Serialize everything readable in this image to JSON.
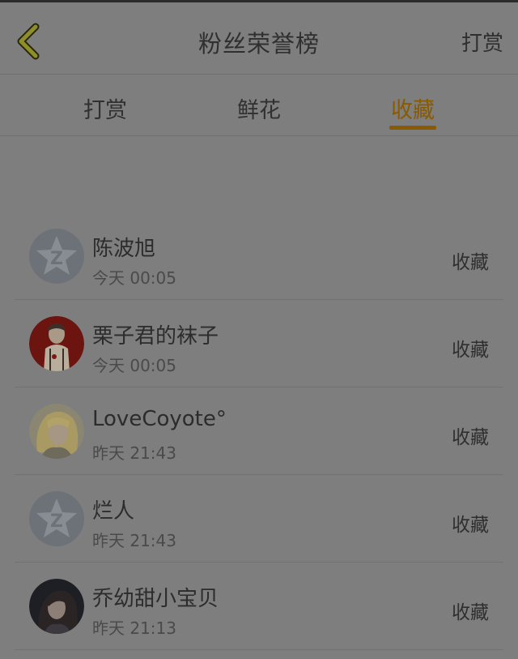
{
  "header": {
    "title": "粉丝荣誉榜",
    "right_button": "打赏",
    "back_icon": "chevron-left-icon"
  },
  "tabs": [
    {
      "label": "打赏",
      "active": false
    },
    {
      "label": "鲜花",
      "active": false
    },
    {
      "label": "收藏",
      "active": true
    }
  ],
  "colors": {
    "accent": "#8a5a00",
    "back_icon": "#8f8f2a",
    "overlay_background": "#7e7e7e"
  },
  "list": [
    {
      "name": "陈波旭",
      "time": "今天 00:05",
      "action": "收藏",
      "avatar": "default-avatar-icon"
    },
    {
      "name": "栗子君的袜子",
      "time": "今天 00:05",
      "action": "收藏",
      "avatar": "illustrated-portrait-avatar"
    },
    {
      "name": "LoveCoyote°",
      "time": "昨天 21:43",
      "action": "收藏",
      "avatar": "blonde-character-avatar"
    },
    {
      "name": "烂人",
      "time": "昨天 21:43",
      "action": "收藏",
      "avatar": "default-avatar-icon"
    },
    {
      "name": "乔幼甜小宝贝",
      "time": "昨天 21:13",
      "action": "收藏",
      "avatar": "photo-portrait-avatar"
    }
  ]
}
